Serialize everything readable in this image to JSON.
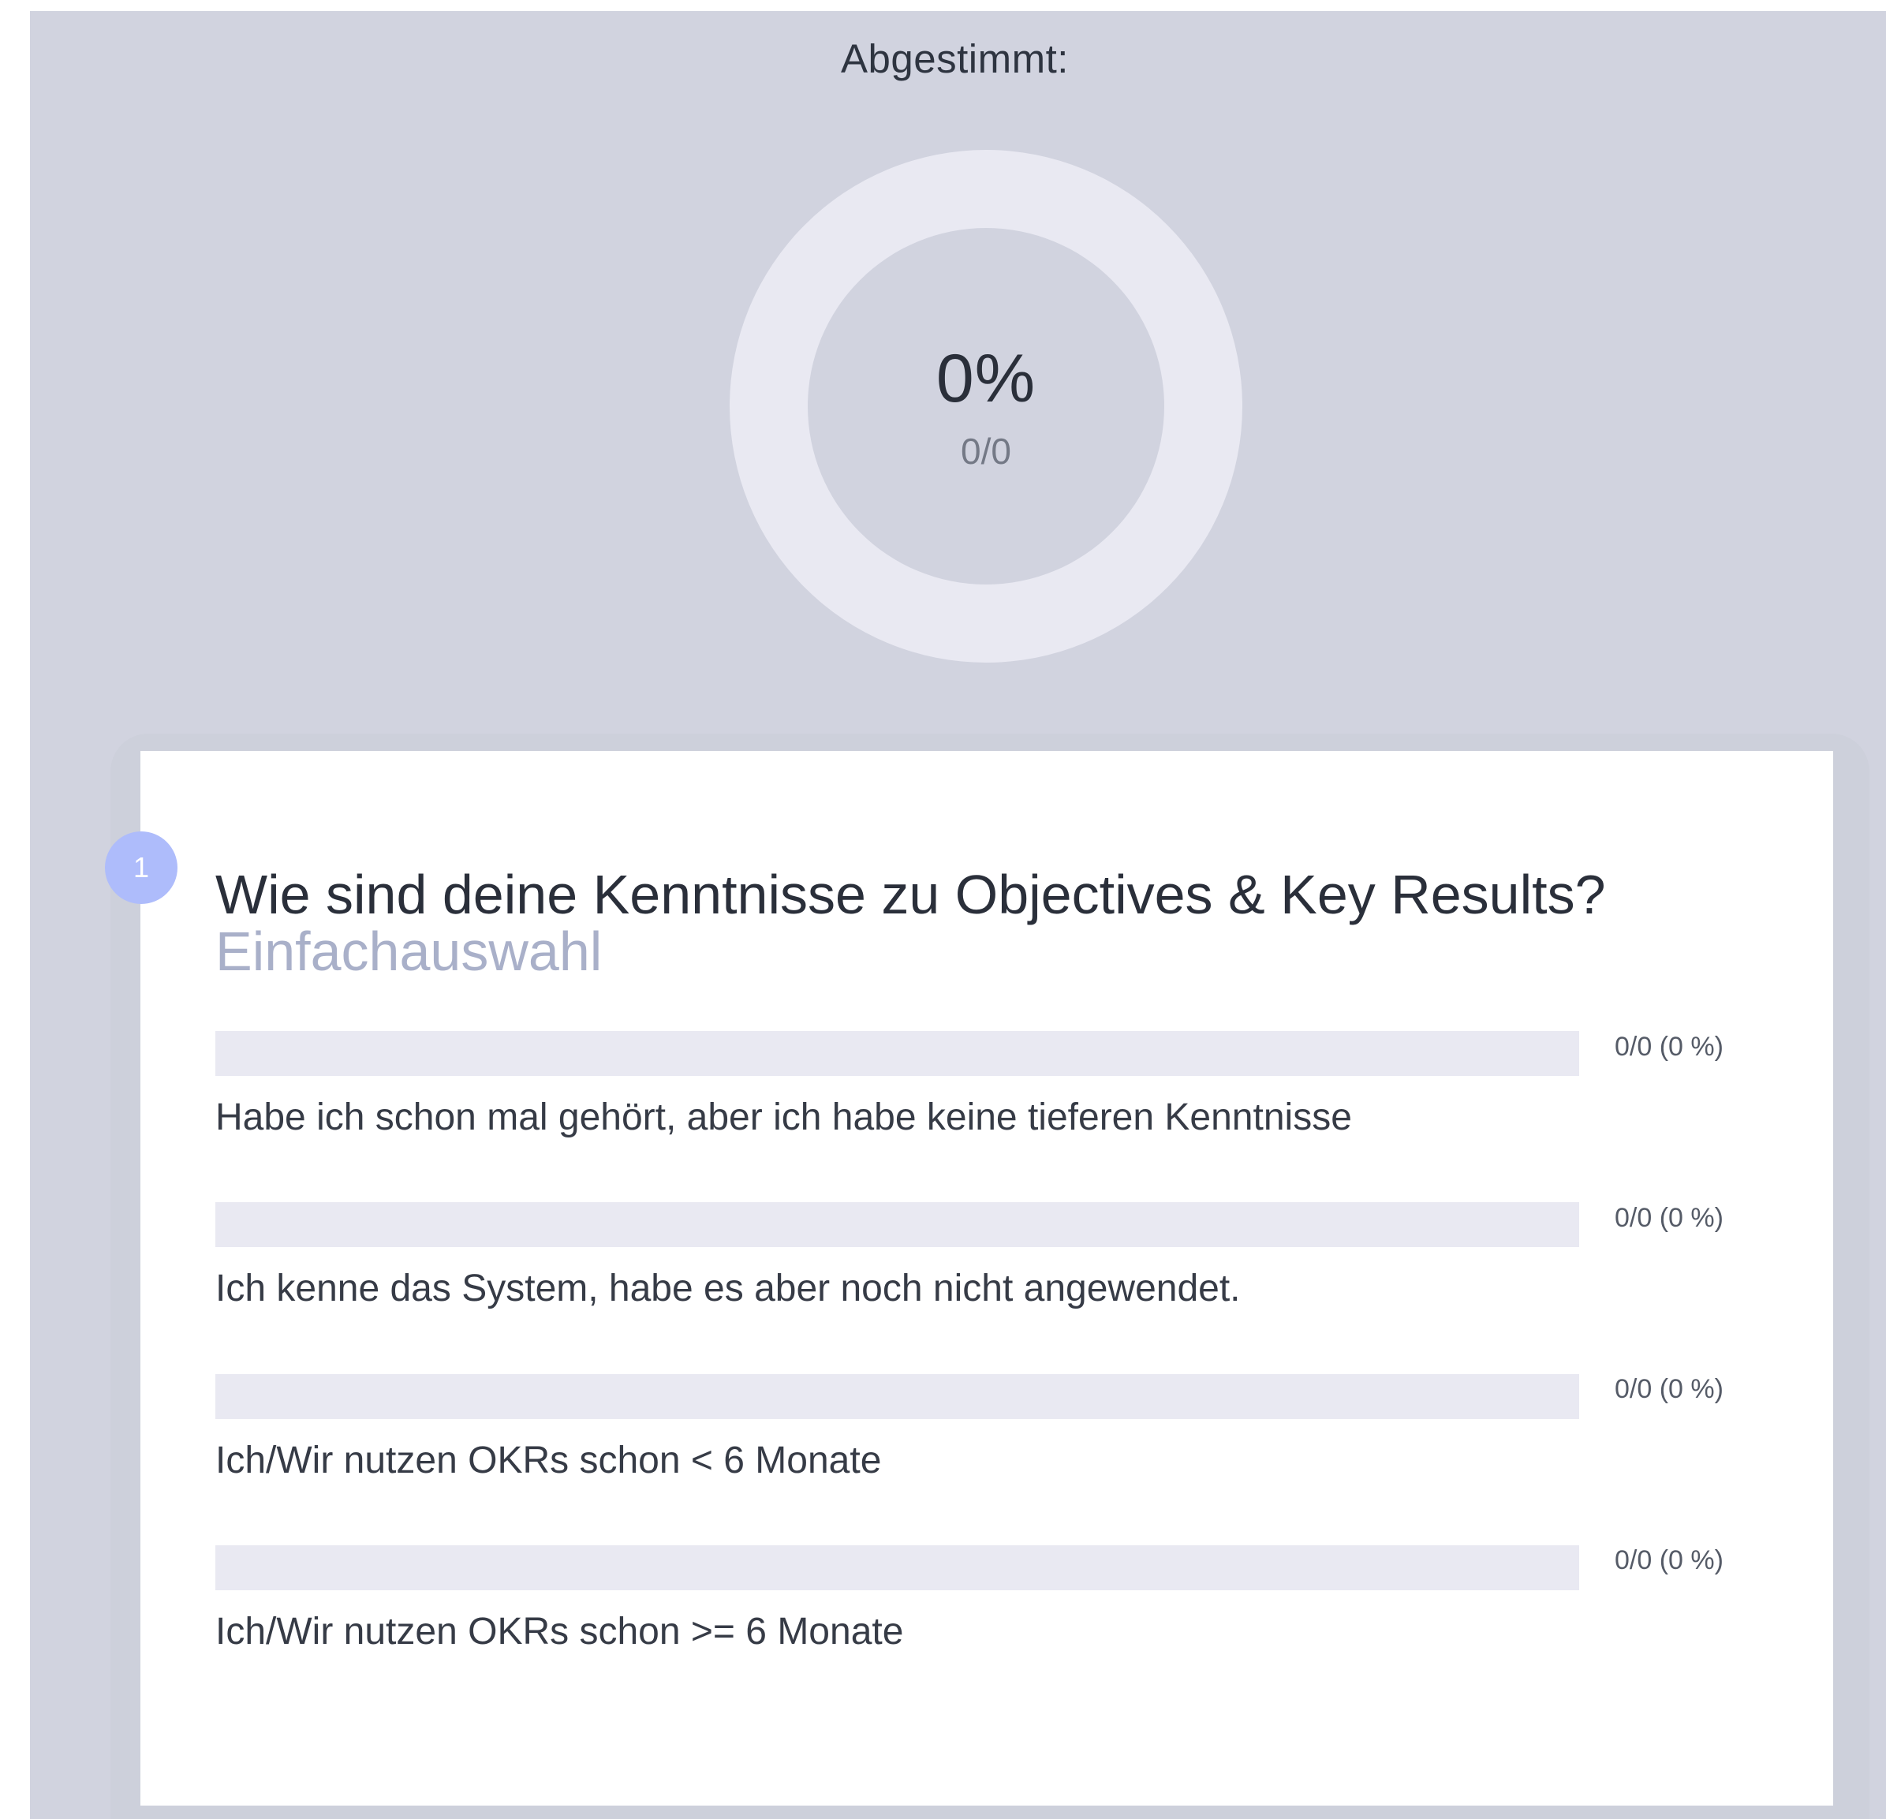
{
  "summary": {
    "label": "Abgestimmt:",
    "percent": "0%",
    "count": "0/0",
    "voted_fraction": 0
  },
  "question": {
    "number": "1",
    "title": "Wie sind deine Kenntnisse zu Objectives & Key Results?",
    "type": "Einfachauswahl",
    "answers": [
      {
        "label": "Habe ich schon mal gehört, aber ich habe keine tieferen Kenntnisse",
        "stat": "0/0 (0 %)",
        "fraction": 0
      },
      {
        "label": "Ich kenne das System, habe es aber noch nicht angewendet.",
        "stat": "0/0 (0 %)",
        "fraction": 0
      },
      {
        "label": "Ich/Wir nutzen OKRs schon < 6 Monate",
        "stat": "0/0 (0 %)",
        "fraction": 0
      },
      {
        "label": "Ich/Wir nutzen OKRs schon >= 6 Monate",
        "stat": "0/0 (0 %)",
        "fraction": 0
      }
    ]
  },
  "colors": {
    "background": "#d1d3df",
    "track": "#e9e9f2",
    "accent": "#aebcfb",
    "subtitle": "#a9b0c9"
  }
}
